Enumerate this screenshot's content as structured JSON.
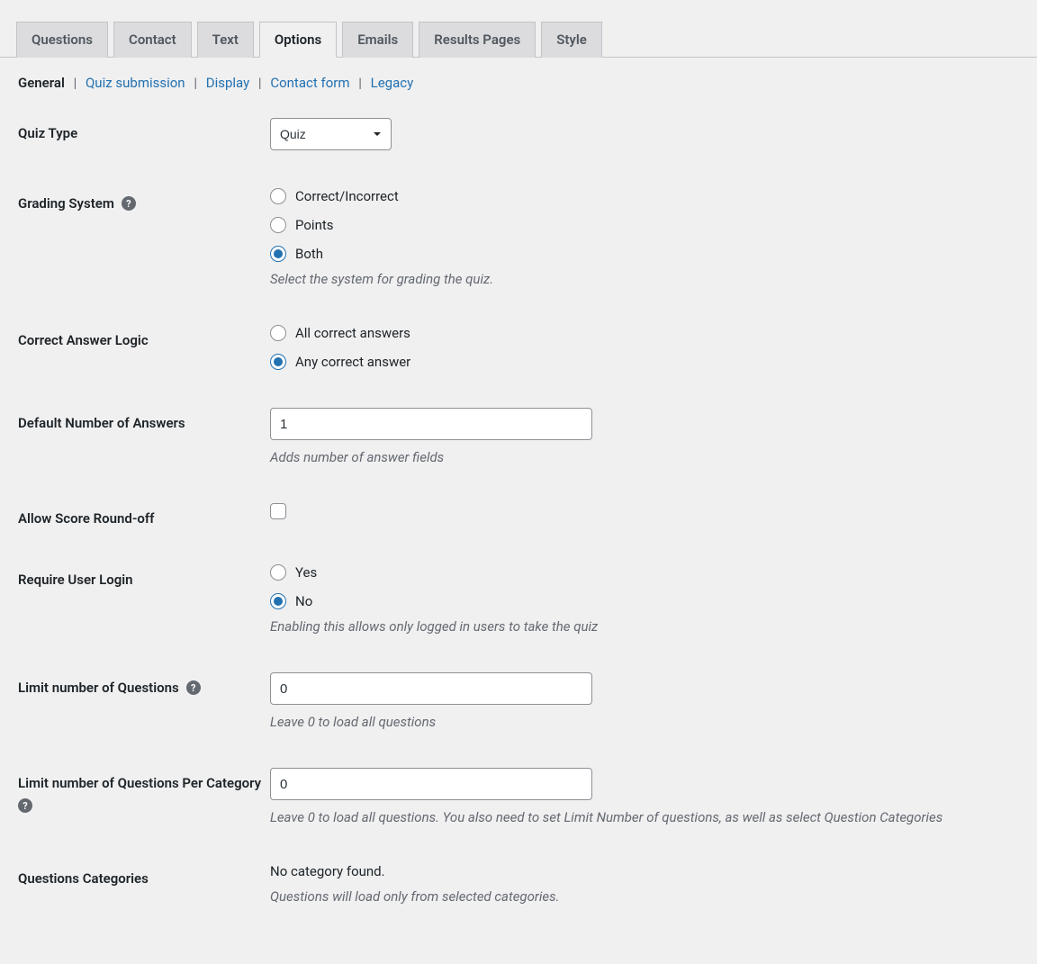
{
  "tabs": [
    "Questions",
    "Contact",
    "Text",
    "Options",
    "Emails",
    "Results Pages",
    "Style"
  ],
  "active_tab_index": 3,
  "subnav": [
    "General",
    "Quiz submission",
    "Display",
    "Contact form",
    "Legacy"
  ],
  "active_subnav_index": 0,
  "fields": {
    "quiz_type": {
      "label": "Quiz Type",
      "value": "Quiz"
    },
    "grading_system": {
      "label": "Grading System",
      "options": [
        "Correct/Incorrect",
        "Points",
        "Both"
      ],
      "selected_index": 2,
      "desc": "Select the system for grading the quiz."
    },
    "correct_answer_logic": {
      "label": "Correct Answer Logic",
      "options": [
        "All correct answers",
        "Any correct answer"
      ],
      "selected_index": 1
    },
    "default_answers": {
      "label": "Default Number of Answers",
      "value": "1",
      "desc": "Adds number of answer fields"
    },
    "allow_roundoff": {
      "label": "Allow Score Round-off",
      "checked": false
    },
    "require_login": {
      "label": "Require User Login",
      "options": [
        "Yes",
        "No"
      ],
      "selected_index": 1,
      "desc": "Enabling this allows only logged in users to take the quiz"
    },
    "limit_questions": {
      "label": "Limit number of Questions",
      "value": "0",
      "desc": "Leave 0 to load all questions"
    },
    "limit_per_category": {
      "label": "Limit number of Questions Per Category",
      "value": "0",
      "desc": "Leave 0 to load all questions. You also need to set Limit Number of questions, as well as select Question Categories"
    },
    "categories": {
      "label": "Questions Categories",
      "text": "No category found.",
      "desc": "Questions will load only from selected categories."
    }
  }
}
